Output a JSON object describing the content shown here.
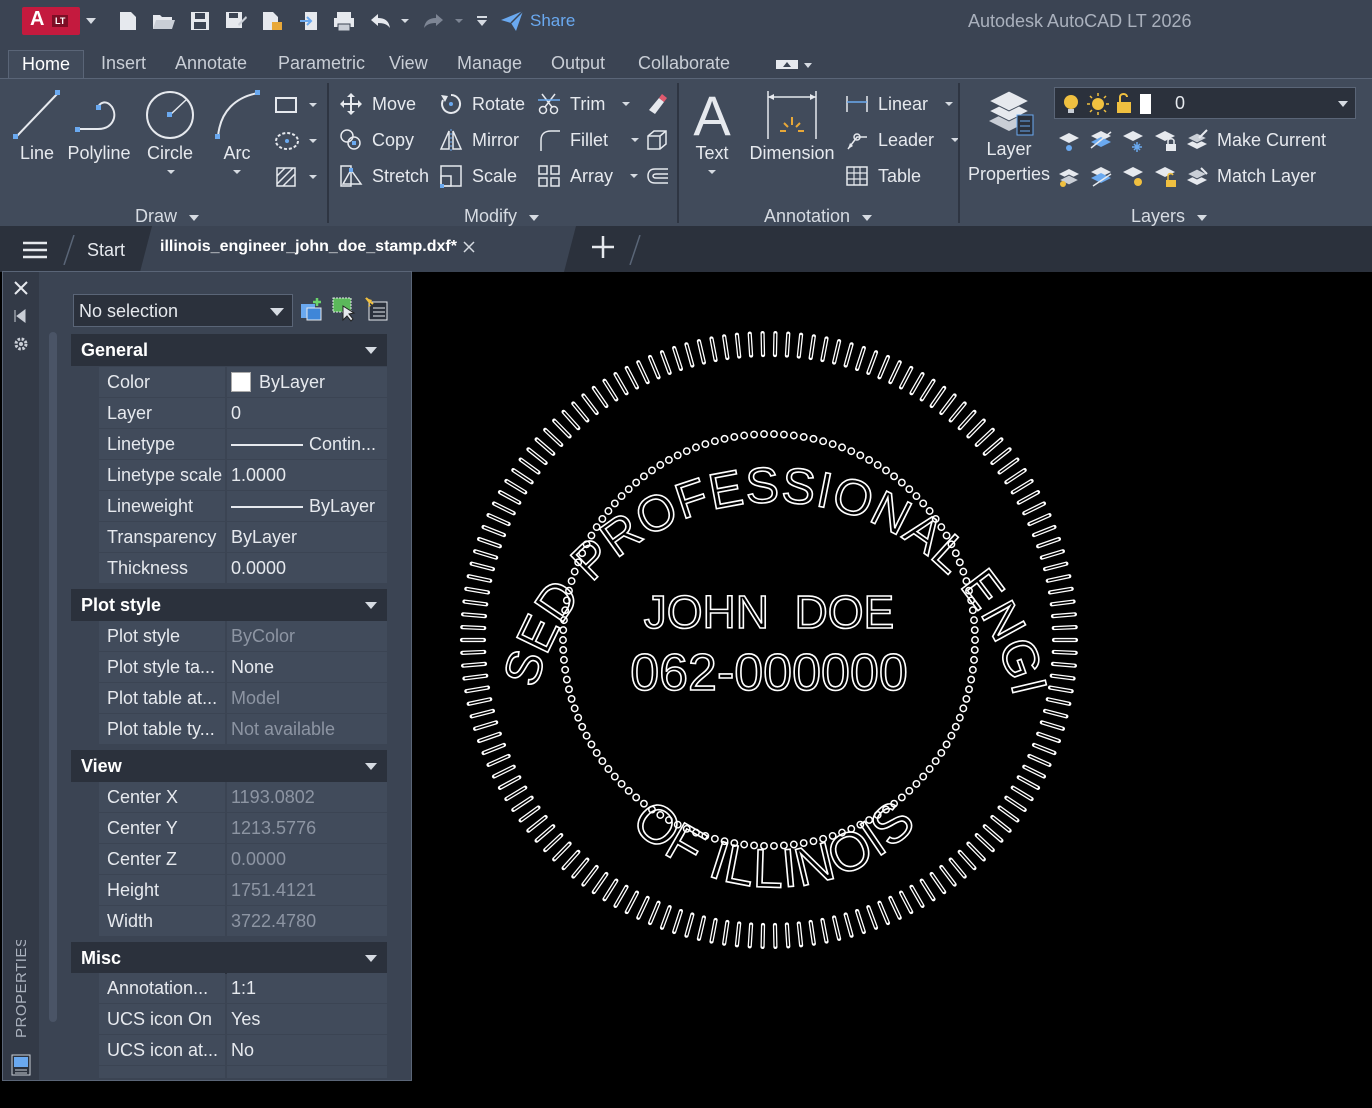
{
  "app": {
    "logo_letter": "A",
    "logo_badge": "LT",
    "window_title": "Autodesk AutoCAD LT 2026",
    "share_label": "Share"
  },
  "ribbon_tabs": [
    "Home",
    "Insert",
    "Annotate",
    "Parametric",
    "View",
    "Manage",
    "Output",
    "Collaborate"
  ],
  "ribbon": {
    "draw": {
      "title": "Draw",
      "line": "Line",
      "polyline": "Polyline",
      "circle": "Circle",
      "arc": "Arc"
    },
    "modify": {
      "title": "Modify",
      "move": "Move",
      "rotate": "Rotate",
      "trim": "Trim",
      "copy": "Copy",
      "mirror": "Mirror",
      "fillet": "Fillet",
      "stretch": "Stretch",
      "scale": "Scale",
      "array": "Array"
    },
    "annotation": {
      "title": "Annotation",
      "text": "Text",
      "dimension": "Dimension",
      "linear": "Linear",
      "leader": "Leader",
      "table": "Table"
    },
    "layers": {
      "title": "Layers",
      "layer_properties_1": "Layer",
      "layer_properties_2": "Properties",
      "current_layer": "0",
      "make_current": "Make Current",
      "match_layer": "Match Layer"
    }
  },
  "file_tabs": {
    "start": "Start",
    "active_file": "illinois_engineer_john_doe_stamp.dxf*"
  },
  "properties": {
    "palette_title": "PROPERTIES",
    "selection": "No selection",
    "general": {
      "title": "General",
      "rows": [
        {
          "key": "Color",
          "value": "ByLayer"
        },
        {
          "key": "Layer",
          "value": "0"
        },
        {
          "key": "Linetype",
          "value": "Contin..."
        },
        {
          "key": "Linetype scale",
          "value": "1.0000"
        },
        {
          "key": "Lineweight",
          "value": "ByLayer"
        },
        {
          "key": "Transparency",
          "value": "ByLayer"
        },
        {
          "key": "Thickness",
          "value": "0.0000"
        }
      ]
    },
    "plot_style": {
      "title": "Plot style",
      "rows": [
        {
          "key": "Plot style",
          "value": "ByColor"
        },
        {
          "key": "Plot style ta...",
          "value": "None"
        },
        {
          "key": "Plot table at...",
          "value": "Model"
        },
        {
          "key": "Plot table ty...",
          "value": "Not available"
        }
      ]
    },
    "view": {
      "title": "View",
      "rows": [
        {
          "key": "Center X",
          "value": "1193.0802"
        },
        {
          "key": "Center Y",
          "value": "1213.5776"
        },
        {
          "key": "Center Z",
          "value": "0.0000"
        },
        {
          "key": "Height",
          "value": "1751.4121"
        },
        {
          "key": "Width",
          "value": "3722.4780"
        }
      ]
    },
    "misc": {
      "title": "Misc",
      "rows": [
        {
          "key": "Annotation...",
          "value": "1:1"
        },
        {
          "key": "UCS icon On",
          "value": "Yes"
        },
        {
          "key": "UCS icon at...",
          "value": "No"
        }
      ]
    }
  },
  "drawing": {
    "arc_text_top": "LICENSED PROFESSIONAL ENGINEER",
    "arc_text_bottom": "OF ILLINOIS",
    "name": "JOHN  DOE",
    "license_number": "062-000000"
  },
  "colors": {
    "ribbon_bg": "#414b5b",
    "title_bg": "#3b4453",
    "logo_red": "#c41a3e",
    "share_blue": "#6aa9f0",
    "canvas_bg": "#000000"
  }
}
